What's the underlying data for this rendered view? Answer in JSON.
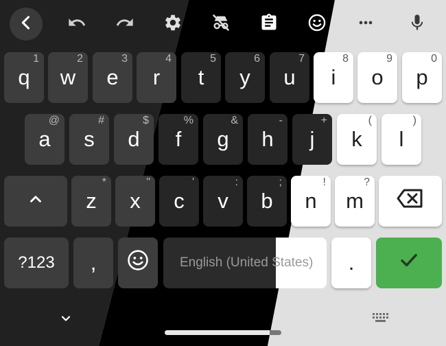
{
  "keyboard": {
    "row1": [
      {
        "label": "q",
        "hint": "1"
      },
      {
        "label": "w",
        "hint": "2"
      },
      {
        "label": "e",
        "hint": "3"
      },
      {
        "label": "r",
        "hint": "4"
      },
      {
        "label": "t",
        "hint": "5"
      },
      {
        "label": "y",
        "hint": "6"
      },
      {
        "label": "u",
        "hint": "7"
      },
      {
        "label": "i",
        "hint": "8"
      },
      {
        "label": "o",
        "hint": "9"
      },
      {
        "label": "p",
        "hint": "0"
      }
    ],
    "row2": [
      {
        "label": "a",
        "hint": "@"
      },
      {
        "label": "s",
        "hint": "#"
      },
      {
        "label": "d",
        "hint": "$"
      },
      {
        "label": "f",
        "hint": "%"
      },
      {
        "label": "g",
        "hint": "&"
      },
      {
        "label": "h",
        "hint": "-"
      },
      {
        "label": "j",
        "hint": "+"
      },
      {
        "label": "k",
        "hint": "("
      },
      {
        "label": "l",
        "hint": ")"
      }
    ],
    "row3": [
      {
        "label": "z",
        "hint": "*"
      },
      {
        "label": "x",
        "hint": "\""
      },
      {
        "label": "c",
        "hint": "'"
      },
      {
        "label": "v",
        "hint": ":"
      },
      {
        "label": "b",
        "hint": ";"
      },
      {
        "label": "n",
        "hint": "!"
      },
      {
        "label": "m",
        "hint": "?"
      }
    ],
    "symbols_label": "?123",
    "comma_label": ",",
    "period_label": ".",
    "space_label": "English (United States)"
  },
  "icons": {
    "back": "chevron-left-icon",
    "undo": "undo-icon",
    "redo": "redo-icon",
    "settings": "gear-icon",
    "incognito": "incognito-off-icon",
    "clipboard": "clipboard-icon",
    "emoji": "smiley-icon",
    "more": "more-horizontal-icon",
    "voice": "microphone-icon",
    "shift": "shift-icon",
    "backspace": "backspace-icon",
    "enter": "checkmark-icon",
    "hide": "chevron-down-icon",
    "switch_keyboard": "keyboard-icon"
  },
  "colors": {
    "grey_key": "#3d3d3d",
    "dark_key": "#262626",
    "white_key": "#ffffff",
    "enter_key": "#4caf50",
    "background_left": "#212121",
    "background_mid": "#000000",
    "background_right": "#e0e0e0"
  }
}
